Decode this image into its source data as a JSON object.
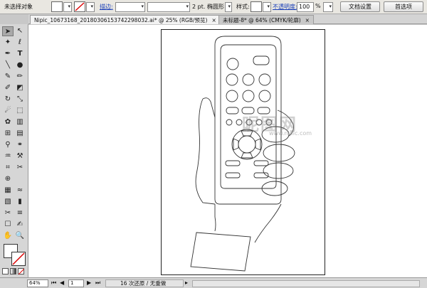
{
  "control_bar": {
    "selection": "未选择对象",
    "stroke_label": "描边:",
    "stroke_weight": "2 pt. 椭圆形",
    "style_label": "样式:",
    "opacity_label": "不透明度:",
    "opacity_value": "100",
    "opacity_unit": "%",
    "doc_settings": "文档设置",
    "preferences": "首选项"
  },
  "tabs": [
    {
      "label": "Nipic_10673168_20180306153742298032.ai* @ 25% (RGB/预览)",
      "close": "×"
    },
    {
      "label": "未标题-8* @ 64% (CMYK/轮廓)",
      "close": "×"
    }
  ],
  "tools": [
    "selection-tool",
    "direct-selection-tool",
    "magic-wand-tool",
    "lasso-tool",
    "pen-tool",
    "type-tool",
    "line-tool",
    "rectangle-tool",
    "paintbrush-tool",
    "pencil-tool",
    "blob-brush-tool",
    "eraser-tool",
    "rotate-tool",
    "scale-tool",
    "warp-tool",
    "free-transform-tool",
    "symbol-sprayer-tool",
    "graph-tool",
    "mesh-tool",
    "gradient-tool",
    "eyedropper-tool",
    "blend-tool",
    "live-paint-tool",
    "live-paint-selection-tool",
    "crop-tool",
    "slice-tool",
    "scissors-tool",
    "hand-tool",
    "zoom-tool"
  ],
  "status": {
    "zoom": "64%",
    "page": "1",
    "history": "16 次还原 / 无重做"
  },
  "watermark": "昵图网",
  "watermark_sub": "www.nipic.com",
  "colors": {
    "toolbar_bg": "#e9e7e1",
    "panel_bg": "#d6d6d6",
    "canvas_bg": "#ffffff",
    "link_blue": "#1a3fb8"
  }
}
